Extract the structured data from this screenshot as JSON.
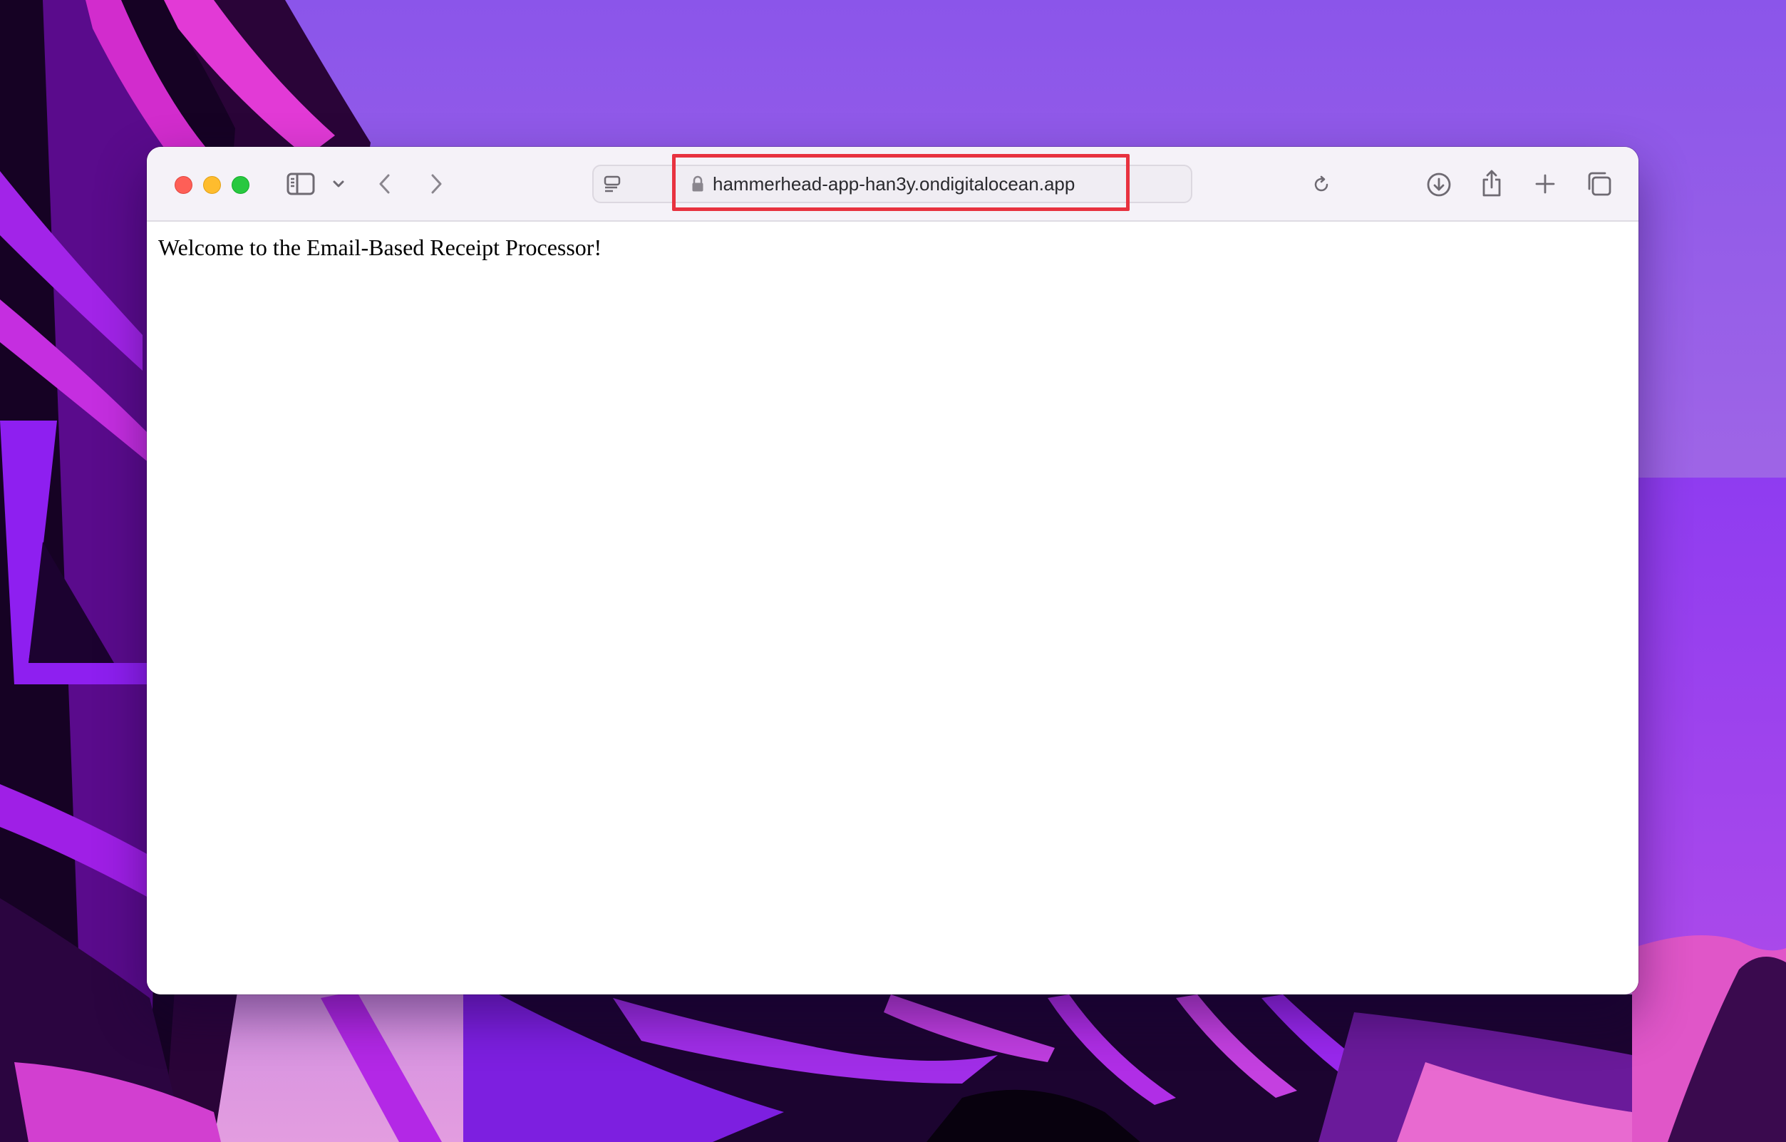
{
  "browser": {
    "address_bar": {
      "url": "hammerhead-app-han3y.ondigitalocean.app",
      "secure": true
    },
    "toolbar_icons": {
      "sidebar": "sidebar-icon",
      "sidebar_menu": "chevron-down-icon",
      "back": "back-arrow-icon",
      "forward": "forward-arrow-icon",
      "page_menu": "page-menu-icon",
      "lock": "lock-icon",
      "reload": "reload-icon",
      "downloads": "download-icon",
      "share": "share-icon",
      "new_tab": "plus-icon",
      "tab_overview": "tabs-icon"
    },
    "annotation_color": "#e8323f"
  },
  "page": {
    "welcome_text": "Welcome to the Email-Based Receipt Processor!"
  }
}
